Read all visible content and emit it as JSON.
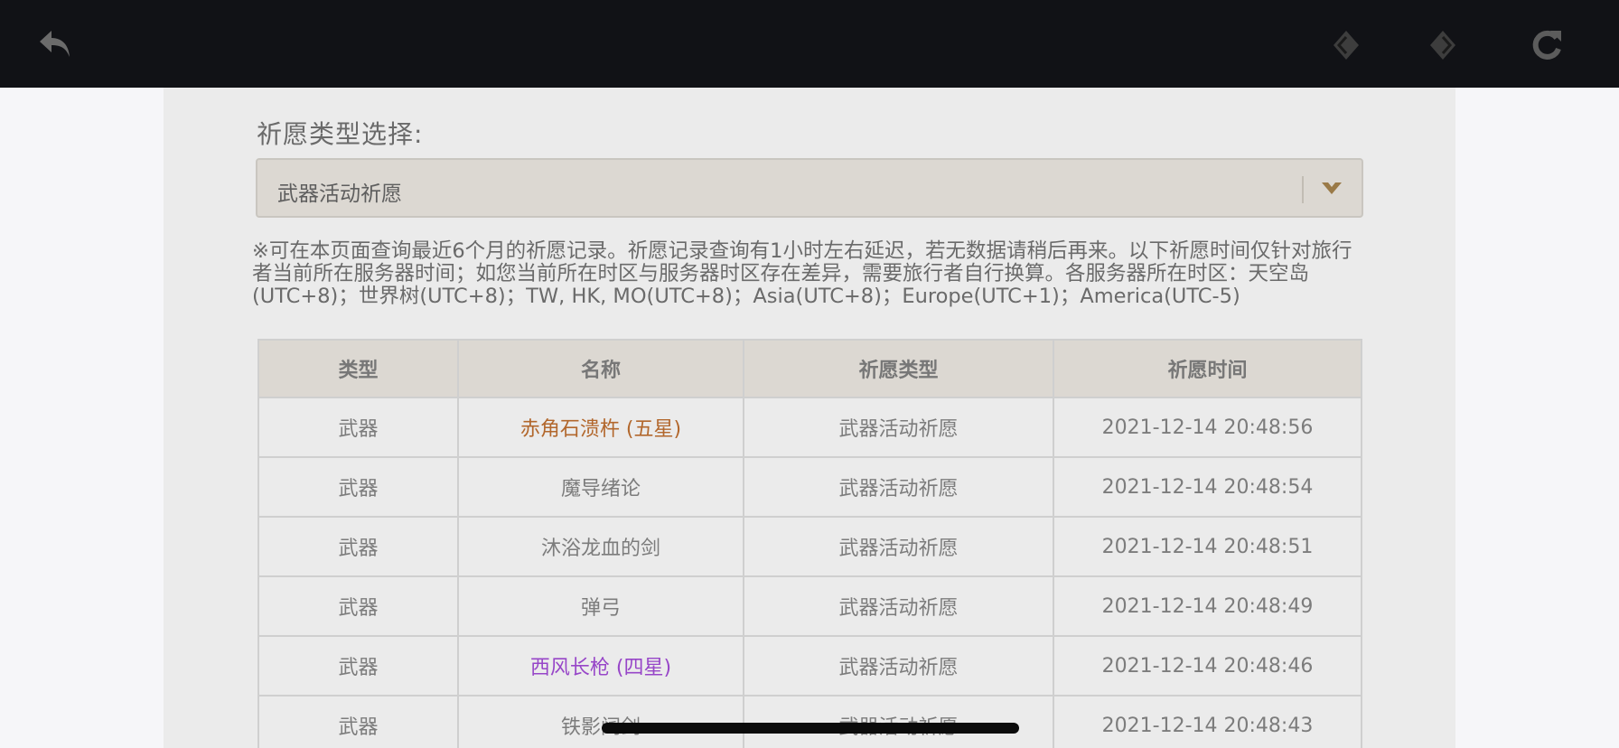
{
  "toolbar": {
    "back_icon": "back-arrow-icon",
    "prev_icon": "prev-diamond-icon",
    "next_icon": "next-diamond-icon",
    "refresh_icon": "refresh-icon"
  },
  "wish_selector": {
    "label": "祈愿类型选择:",
    "selected": "武器活动祈愿",
    "icon": "chevron-down-icon"
  },
  "notice": "※可在本页面查询最近6个月的祈愿记录。祈愿记录查询有1小时左右延迟，若无数据请稍后再来。以下祈愿时间仅针对旅行者当前所在服务器时间；如您当前所在时区与服务器时区存在差异，需要旅行者自行换算。各服务器所在时区：天空岛(UTC+8)；世界树(UTC+8)；TW, HK, MO(UTC+8)；Asia(UTC+8)；Europe(UTC+1)；America(UTC-5)",
  "table": {
    "headers": [
      "类型",
      "名称",
      "祈愿类型",
      "祈愿时间"
    ],
    "rows": [
      {
        "type": "武器",
        "name": "赤角石溃杵 (五星)",
        "wish_type": "武器活动祈愿",
        "time": "2021-12-14 20:48:56",
        "color": "#b2672c"
      },
      {
        "type": "武器",
        "name": "魔导绪论",
        "wish_type": "武器活动祈愿",
        "time": "2021-12-14 20:48:54",
        "color": "#7c7c7c"
      },
      {
        "type": "武器",
        "name": "沐浴龙血的剑",
        "wish_type": "武器活动祈愿",
        "time": "2021-12-14 20:48:51",
        "color": "#7c7c7c"
      },
      {
        "type": "武器",
        "name": "弹弓",
        "wish_type": "武器活动祈愿",
        "time": "2021-12-14 20:48:49",
        "color": "#7c7c7c"
      },
      {
        "type": "武器",
        "name": "西风长枪 (四星)",
        "wish_type": "武器活动祈愿",
        "time": "2021-12-14 20:48:46",
        "color": "#9746c8"
      },
      {
        "type": "武器",
        "name": "铁影阔剑",
        "wish_type": "武器活动祈愿",
        "time": "2021-12-14 20:48:43",
        "color": "#7c7c7c"
      }
    ]
  }
}
